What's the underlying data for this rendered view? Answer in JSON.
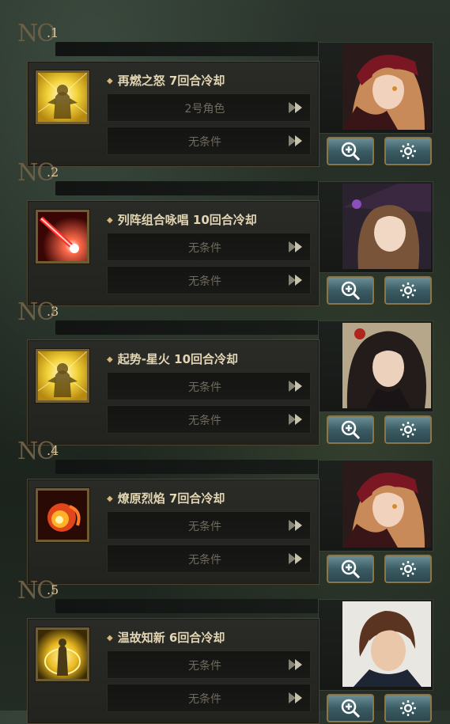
{
  "slots": [
    {
      "no_prefix": "N",
      "no_o": "O",
      "num": ".1",
      "skill": "再燃之怒 7回合冷却",
      "cond1": "2号角色",
      "cond2": "无条件",
      "icon": "buff-fist-icon",
      "portrait": "red-hood-girl-portrait"
    },
    {
      "no_prefix": "N",
      "no_o": "O",
      "num": ".2",
      "skill": "列阵组合咏唱 10回合冷却",
      "cond1": "无条件",
      "cond2": "无条件",
      "icon": "red-slash-icon",
      "portrait": "witch-hat-girl-portrait"
    },
    {
      "no_prefix": "N",
      "no_o": "O",
      "num": ".3",
      "skill": "起势-星火 10回合冷却",
      "cond1": "无条件",
      "cond2": "无条件",
      "icon": "buff-fist-icon",
      "portrait": "black-hair-woman-portrait"
    },
    {
      "no_prefix": "N",
      "no_o": "O",
      "num": ".4",
      "skill": "燎原烈焰 7回合冷却",
      "cond1": "无条件",
      "cond2": "无条件",
      "icon": "fireball-icon",
      "portrait": "red-hood-girl-portrait"
    },
    {
      "no_prefix": "N",
      "no_o": "O",
      "num": ".5",
      "skill": "温故知新 6回合冷却",
      "cond1": "无条件",
      "cond2": "无条件",
      "icon": "golden-aura-icon",
      "portrait": "brown-hair-man-portrait"
    }
  ],
  "colors": {
    "gold": "#d7b67a",
    "teal_button": "#3b5c64",
    "card": "#22231f"
  }
}
